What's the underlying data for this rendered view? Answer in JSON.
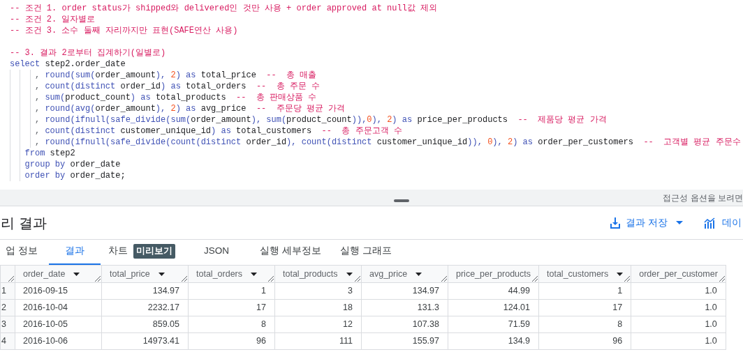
{
  "editor": {
    "lines": [
      {
        "tokens": [
          {
            "kind": "comment",
            "text": "-- 조건 1. order status가 shipped와 delivered인 것만 사용 + order approved at null값 제외"
          }
        ]
      },
      {
        "tokens": [
          {
            "kind": "comment",
            "text": "-- 조건 2. 일자별로"
          }
        ]
      },
      {
        "tokens": [
          {
            "kind": "comment",
            "text": "-- 조건 3. 소수 둘째 자리까지만 표현(SAFE연산 사용)"
          }
        ]
      },
      {
        "kind": "blank"
      },
      {
        "tokens": [
          {
            "kind": "comment",
            "text": "-- 3. 결과 2로부터 집계하기(일별로)"
          }
        ]
      },
      {
        "tokens": [
          {
            "kind": "keyword",
            "text": "select"
          },
          {
            "kind": "ident",
            "text": " step2.order_date"
          }
        ]
      },
      {
        "tokens": [
          {
            "kind": "punct",
            "text": "     , "
          },
          {
            "kind": "function",
            "text": "round(sum("
          },
          {
            "kind": "ident",
            "text": "order_amount"
          },
          {
            "kind": "function",
            "text": "), "
          },
          {
            "kind": "number",
            "text": "2"
          },
          {
            "kind": "function",
            "text": ") as "
          },
          {
            "kind": "ident",
            "text": "total_price  "
          },
          {
            "kind": "comment",
            "text": "--  총 매출"
          }
        ]
      },
      {
        "tokens": [
          {
            "kind": "punct",
            "text": "     , "
          },
          {
            "kind": "function",
            "text": "count(distinct "
          },
          {
            "kind": "ident",
            "text": "order_id"
          },
          {
            "kind": "function",
            "text": ") as "
          },
          {
            "kind": "ident",
            "text": "total_orders  "
          },
          {
            "kind": "comment",
            "text": "--  총 주문 수"
          }
        ]
      },
      {
        "tokens": [
          {
            "kind": "punct",
            "text": "     , "
          },
          {
            "kind": "function",
            "text": "sum("
          },
          {
            "kind": "ident",
            "text": "product_count"
          },
          {
            "kind": "function",
            "text": ") as "
          },
          {
            "kind": "ident",
            "text": "total_products  "
          },
          {
            "kind": "comment",
            "text": "--  총 판매상품 수"
          }
        ]
      },
      {
        "tokens": [
          {
            "kind": "punct",
            "text": "     , "
          },
          {
            "kind": "function",
            "text": "round(avg("
          },
          {
            "kind": "ident",
            "text": "order_amount"
          },
          {
            "kind": "function",
            "text": "), "
          },
          {
            "kind": "number",
            "text": "2"
          },
          {
            "kind": "function",
            "text": ") as "
          },
          {
            "kind": "ident",
            "text": "avg_price  "
          },
          {
            "kind": "comment",
            "text": "--  주문당 평균 가격"
          }
        ]
      },
      {
        "tokens": [
          {
            "kind": "punct",
            "text": "     , "
          },
          {
            "kind": "function",
            "text": "round(ifnull(safe_divide(sum("
          },
          {
            "kind": "ident",
            "text": "order_amount"
          },
          {
            "kind": "function",
            "text": "), sum("
          },
          {
            "kind": "ident",
            "text": "product_count"
          },
          {
            "kind": "function",
            "text": ")),"
          },
          {
            "kind": "number",
            "text": "0"
          },
          {
            "kind": "function",
            "text": "), "
          },
          {
            "kind": "number",
            "text": "2"
          },
          {
            "kind": "function",
            "text": ") as "
          },
          {
            "kind": "ident",
            "text": "price_per_products  "
          },
          {
            "kind": "comment",
            "text": "--  제품당 평균 가격"
          }
        ]
      },
      {
        "tokens": [
          {
            "kind": "punct",
            "text": "     , "
          },
          {
            "kind": "function",
            "text": "count(distinct "
          },
          {
            "kind": "ident",
            "text": "customer_unique_id"
          },
          {
            "kind": "function",
            "text": ") as "
          },
          {
            "kind": "ident",
            "text": "total_customers  "
          },
          {
            "kind": "comment",
            "text": "--  총 주문고객 수"
          }
        ]
      },
      {
        "tokens": [
          {
            "kind": "punct",
            "text": "     , "
          },
          {
            "kind": "function",
            "text": "round(ifnull(safe_divide(count(distinct "
          },
          {
            "kind": "ident",
            "text": "order_id"
          },
          {
            "kind": "function",
            "text": "), count(distinct "
          },
          {
            "kind": "ident",
            "text": "customer_unique_id"
          },
          {
            "kind": "function",
            "text": ")), "
          },
          {
            "kind": "number",
            "text": "0"
          },
          {
            "kind": "function",
            "text": "), "
          },
          {
            "kind": "number",
            "text": "2"
          },
          {
            "kind": "function",
            "text": ") as "
          },
          {
            "kind": "ident",
            "text": "order_per_customers  "
          },
          {
            "kind": "comment",
            "text": "--  고객별 평균 주문수"
          }
        ]
      },
      {
        "tokens": [
          {
            "kind": "keyword",
            "text": "   from"
          },
          {
            "kind": "ident",
            "text": " step2"
          }
        ]
      },
      {
        "tokens": [
          {
            "kind": "keyword",
            "text": "   group by"
          },
          {
            "kind": "ident",
            "text": " order_date"
          }
        ]
      },
      {
        "tokens": [
          {
            "kind": "keyword",
            "text": "   order by"
          },
          {
            "kind": "ident",
            "text": " order_date;"
          }
        ]
      }
    ],
    "status_text": "접근성 옵션을 보려면"
  },
  "results": {
    "title": "리 결과",
    "actions": [
      {
        "kind": "save",
        "label": "결과 저장"
      },
      {
        "kind": "explore",
        "label": "데이"
      }
    ],
    "tabs": [
      {
        "label": "업 정보",
        "selected": false
      },
      {
        "label": "결과",
        "selected": true
      },
      {
        "label": "차트",
        "badge": "미리보기",
        "selected": false
      },
      {
        "label": "JSON",
        "selected": false
      },
      {
        "label": "실행 세부정보",
        "selected": false
      },
      {
        "label": "실행 그래프",
        "selected": false
      }
    ],
    "table": {
      "columns": [
        {
          "label": "order_date",
          "caret": true
        },
        {
          "label": "total_price",
          "caret": true
        },
        {
          "label": "total_orders",
          "caret": true
        },
        {
          "label": "total_products",
          "caret": true
        },
        {
          "label": "avg_price",
          "caret": true
        },
        {
          "label": "price_per_products",
          "caret": false
        },
        {
          "label": "total_customers",
          "caret": true
        },
        {
          "label": "order_per_customer",
          "caret": false
        }
      ],
      "rows": [
        {
          "index": "1",
          "cells": [
            "2016-09-15",
            "134.97",
            "1",
            "3",
            "134.97",
            "44.99",
            "1",
            "1.0"
          ]
        },
        {
          "index": "2",
          "cells": [
            "2016-10-04",
            "2232.17",
            "17",
            "18",
            "131.3",
            "124.01",
            "17",
            "1.0"
          ]
        },
        {
          "index": "3",
          "cells": [
            "2016-10-05",
            "859.05",
            "8",
            "12",
            "107.38",
            "71.59",
            "8",
            "1.0"
          ]
        },
        {
          "index": "4",
          "cells": [
            "2016-10-06",
            "14973.41",
            "96",
            "111",
            "155.97",
            "134.9",
            "96",
            "1.0"
          ]
        }
      ]
    }
  }
}
